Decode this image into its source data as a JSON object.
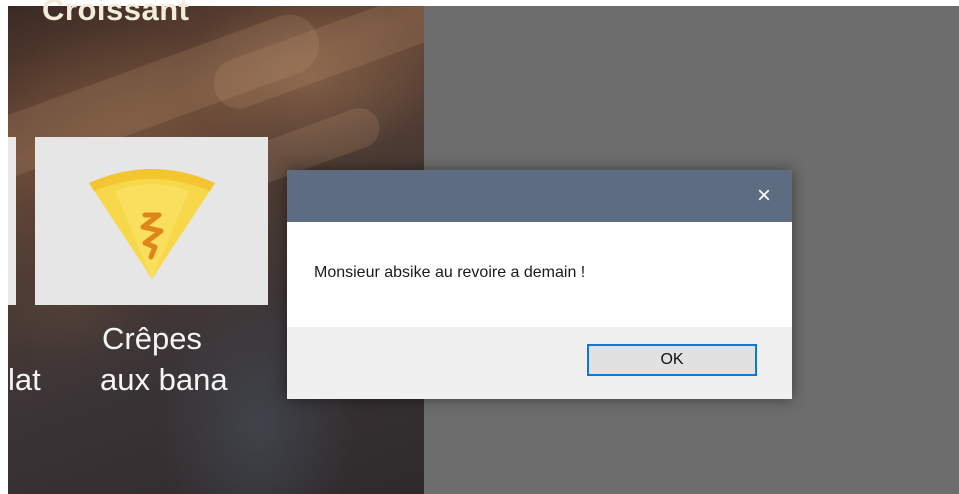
{
  "menu": {
    "top_item_label": "Croissant",
    "crepe_item": {
      "label_line1": "Crêpes",
      "label_line2": "aux bana"
    },
    "left_partial_label": "lat"
  },
  "dialog": {
    "close_icon": "×",
    "message": "Monsieur absike au revoire a demain !",
    "ok_label": "OK"
  },
  "colors": {
    "dialog_titlebar": "#5d6c80",
    "overlay": "#6d6d6d",
    "ok_border": "#0f78d7"
  }
}
